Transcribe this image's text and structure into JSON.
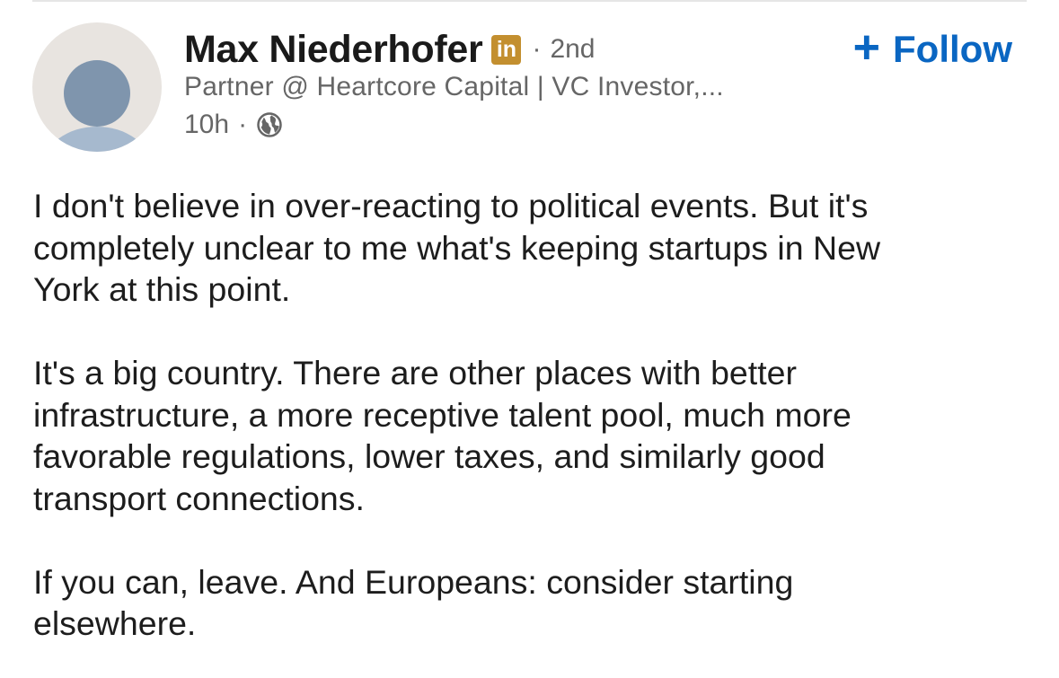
{
  "post": {
    "author": {
      "name": "Max Niederhofer",
      "badge": "in",
      "degree": "2nd",
      "headline": "Partner @ Heartcore Capital | VC Investor,...",
      "time": "10h",
      "visibility_icon": "globe-icon"
    },
    "follow": {
      "icon": "plus-icon",
      "plus": "+",
      "label": "Follow"
    },
    "paragraphs": [
      {
        "lines": [
          "I don't believe in over-reacting to political events. But it's",
          "completely unclear to me what's keeping startups in New",
          "York at this point."
        ]
      },
      {
        "lines": [
          "It's a big country. There are other places with better",
          "infrastructure, a more receptive talent pool, much more",
          "favorable regulations, lower taxes, and similarly good",
          "transport connections."
        ]
      },
      {
        "lines": [
          "If you can, leave. And Europeans: consider starting",
          "elsewhere."
        ]
      }
    ],
    "separator": "·"
  },
  "colors": {
    "follow_blue": "#0a66c2",
    "badge_gold": "#c38f2f",
    "secondary_text": "#666666",
    "body_text": "#1d1d1d"
  }
}
